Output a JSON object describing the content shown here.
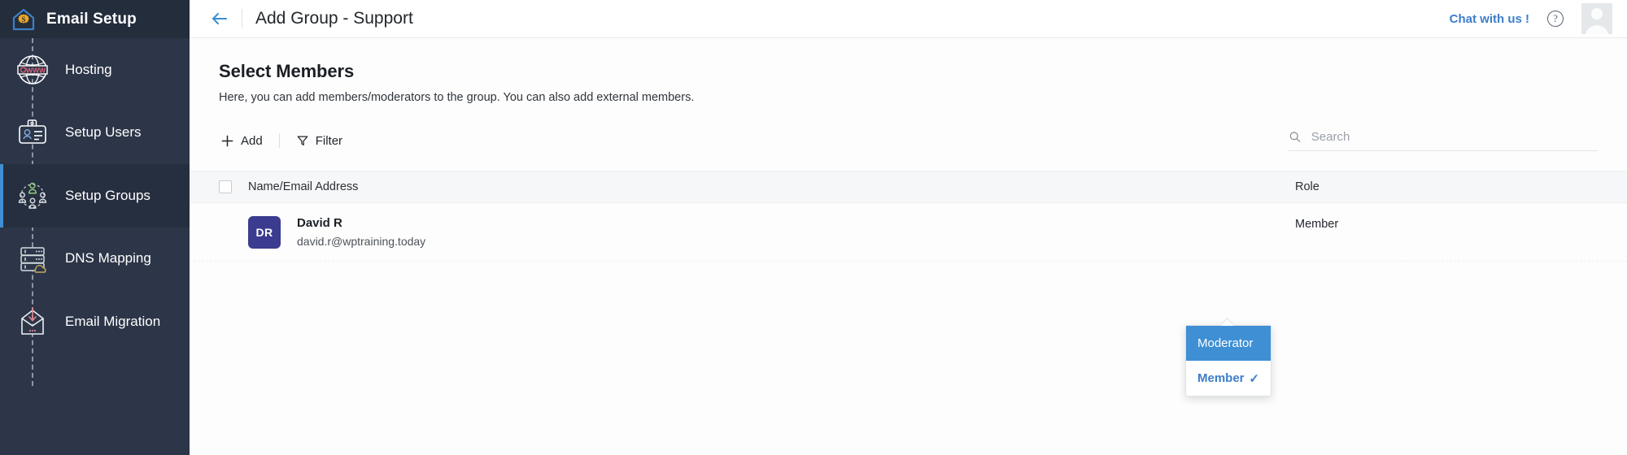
{
  "sidebar": {
    "brand": {
      "title": "Email Setup",
      "logo_icon": "house-gear-icon"
    },
    "items": [
      {
        "label": "Hosting",
        "icon": "globe-www-icon",
        "active": false
      },
      {
        "label": "Setup Users",
        "icon": "id-card-icon",
        "active": false
      },
      {
        "label": "Setup Groups",
        "icon": "group-users-icon",
        "active": true
      },
      {
        "label": "DNS Mapping",
        "icon": "server-cloud-icon",
        "active": false
      },
      {
        "label": "Email Migration",
        "icon": "envelope-download-icon",
        "active": false
      }
    ]
  },
  "topbar": {
    "back_icon": "arrow-left-icon",
    "title": "Add Group - Support",
    "chat_label": "Chat with us !",
    "help_icon": "question-mark-icon",
    "help_glyph": "?",
    "avatar_icon": "user-avatar-icon"
  },
  "content": {
    "title": "Select Members",
    "description": "Here, you can add members/moderators to the group. You can also add external members."
  },
  "toolbar": {
    "add_label": "Add",
    "add_icon": "plus-icon",
    "filter_label": "Filter",
    "filter_icon": "funnel-icon",
    "search_placeholder": "Search",
    "search_value": "",
    "search_icon": "search-icon"
  },
  "table": {
    "columns": {
      "name": "Name/Email Address",
      "role": "Role"
    },
    "rows": [
      {
        "initials": "DR",
        "name": "David R",
        "email": "david.r@wptraining.today",
        "role": "Member"
      }
    ]
  },
  "dropdown": {
    "open": true,
    "items": [
      {
        "label": "Moderator",
        "highlighted": true,
        "selected": false
      },
      {
        "label": "Member",
        "highlighted": false,
        "selected": true
      }
    ],
    "check_glyph": "✓"
  },
  "colors": {
    "sidebar_bg": "#2c3648",
    "sidebar_brand_bg": "#242d3c",
    "sidebar_active_bg": "#262f3f",
    "accent_blue": "#3f8fd4",
    "link_blue": "#3b7dca",
    "avatar_purple": "#3b3b8f",
    "logo_gold": "#f0a820",
    "table_header_bg": "#f6f7f8"
  }
}
